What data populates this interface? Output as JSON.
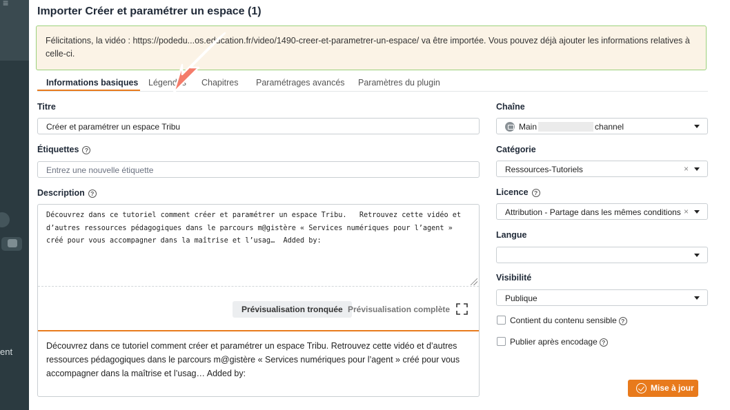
{
  "sidebar": {
    "bottom_text": "ent"
  },
  "page": {
    "title": "Importer Créer et paramétrer un espace (1)"
  },
  "alert": {
    "message": "Félicitations, la vidéo : https://podedu...os.education.fr/video/1490-creer-et-parametrer-un-espace/ va être importée. Vous pouvez déjà ajouter les informations relatives à celle-ci."
  },
  "tabs": [
    {
      "label": "Informations basiques",
      "active": true
    },
    {
      "label": "Légendes",
      "active": false
    },
    {
      "label": "Chapitres",
      "active": false
    },
    {
      "label": "Paramétrages avancés",
      "active": false
    },
    {
      "label": "Paramètres du plugin",
      "active": false
    }
  ],
  "form": {
    "title": {
      "label": "Titre",
      "value": "Créer et paramétrer un espace Tribu"
    },
    "tags": {
      "label": "Étiquettes",
      "placeholder": "Entrez une nouvelle étiquette"
    },
    "description": {
      "label": "Description",
      "editor_text": "Découvrez dans ce tutoriel comment créer et paramétrer un espace Tribu.   Retrouvez cette vidéo et d’autres ressources pédagogiques dans le parcours m@gistère « Services numériques pour l’agent » créé pour vous accompagner dans la maîtrise et l’usag…  Added by:",
      "preview_truncated_label": "Prévisualisation tronquée",
      "preview_full_label": "Prévisualisation complète",
      "preview_text": "Découvrez dans ce tutoriel comment créer et paramétrer un espace Tribu. Retrouvez cette vidéo et d’autres ressources pédagogiques dans le parcours m@gistère « Services numériques pour l’agent » créé pour vous accompagner dans la maîtrise et l’usag… Added by:"
    },
    "channel": {
      "label": "Chaîne",
      "value_prefix": "Main",
      "value_suffix": "channel"
    },
    "category": {
      "label": "Catégorie",
      "value": "Ressources-Tutoriels"
    },
    "license": {
      "label": "Licence",
      "value": "Attribution - Partage dans les mêmes conditions"
    },
    "language": {
      "label": "Langue",
      "value": ""
    },
    "visibility": {
      "label": "Visibilité",
      "value": "Publique"
    },
    "sensitive": {
      "label": "Contient du contenu sensible",
      "checked": false
    },
    "publish_after_encoding": {
      "label": "Publier après encodage",
      "checked": false
    },
    "submit_label": "Mise à jour"
  },
  "annotation": {
    "arrow_color": "#f47c6a"
  }
}
